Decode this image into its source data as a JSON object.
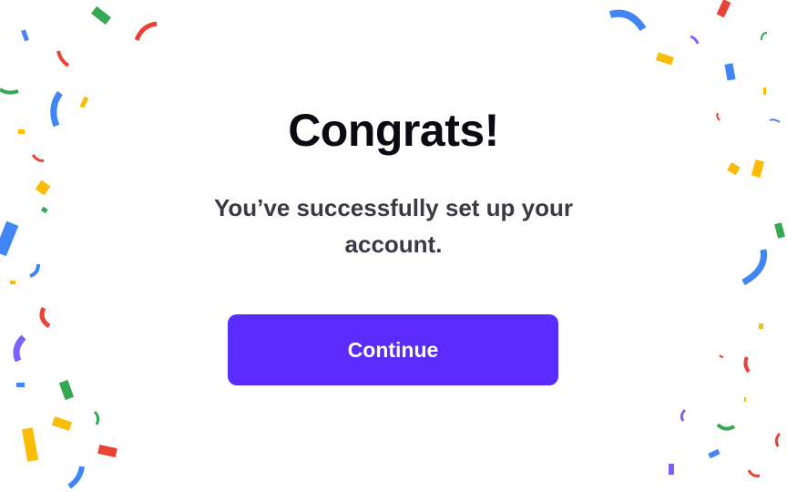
{
  "dialog": {
    "title": "Congrats!",
    "message": "You’ve successfully set up your account.",
    "continue_label": "Continue"
  },
  "colors": {
    "primary": "#5a2bff",
    "title_text": "#0a0a12",
    "message_text": "#3a3a44",
    "confetti": [
      "#4285f4",
      "#ea4335",
      "#34a853",
      "#fbbc05",
      "#7b61ff"
    ]
  }
}
